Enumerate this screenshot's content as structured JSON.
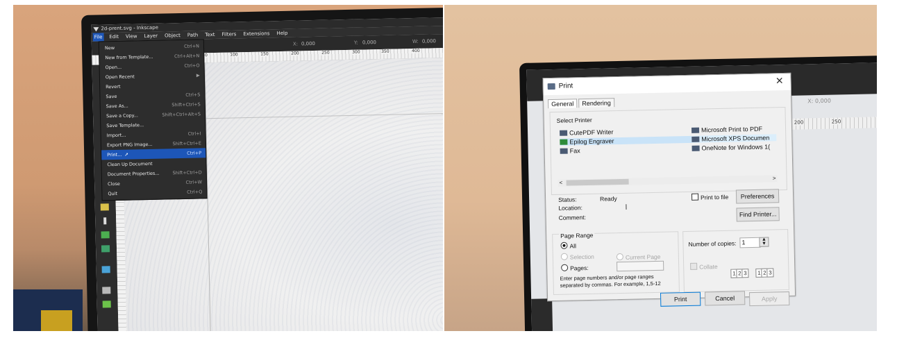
{
  "left": {
    "window_title": "2d-prent.svg - Inkscape",
    "menubar": [
      "File",
      "Edit",
      "View",
      "Layer",
      "Object",
      "Path",
      "Text",
      "Filters",
      "Extensions",
      "Help"
    ],
    "toolbar": {
      "x_label": "X:",
      "x_value": "0,000",
      "y_label": "Y:",
      "y_value": "0,000",
      "w_label": "W:",
      "w_value": "0,000"
    },
    "ruler": [
      "50",
      "100",
      "150",
      "200",
      "250",
      "300",
      "350",
      "400"
    ],
    "file_menu": [
      {
        "label": "New",
        "shortcut": "Ctrl+N"
      },
      {
        "label": "New from Template...",
        "shortcut": "Ctrl+Alt+N"
      },
      {
        "label": "Open...",
        "shortcut": "Ctrl+O"
      },
      {
        "label": "Open Recent",
        "shortcut": "▶"
      },
      {
        "label": "Revert",
        "shortcut": ""
      },
      {
        "label": "Save",
        "shortcut": "Ctrl+S"
      },
      {
        "label": "Save As...",
        "shortcut": "Shift+Ctrl+S"
      },
      {
        "label": "Save a Copy...",
        "shortcut": "Shift+Ctrl+Alt+S"
      },
      {
        "label": "Save Template...",
        "shortcut": ""
      },
      {
        "label": "Import...",
        "shortcut": "Ctrl+I"
      },
      {
        "label": "Export PNG Image...",
        "shortcut": "Shift+Ctrl+E"
      },
      {
        "label": "Print...",
        "shortcut": "Ctrl+P"
      },
      {
        "label": "Clean Up Document",
        "shortcut": ""
      },
      {
        "label": "Document Properties...",
        "shortcut": "Shift+Ctrl+D"
      },
      {
        "label": "Close",
        "shortcut": "Ctrl+W"
      },
      {
        "label": "Quit",
        "shortcut": "Ctrl+Q"
      }
    ],
    "selected_item": "Print..."
  },
  "right": {
    "bg_toolbar": {
      "x_label": "X:",
      "x_value": "0,000"
    },
    "bg_ruler": [
      "200",
      "250"
    ],
    "dialog": {
      "title": "Print",
      "close": "✕",
      "tabs": [
        "General",
        "Rendering"
      ],
      "select_printer_label": "Select Printer",
      "printers_col1": [
        "CutePDF Writer",
        "Epilog Engraver",
        "Fax"
      ],
      "printers_col2": [
        "Microsoft Print to PDF",
        "Microsoft XPS Documen",
        "OneNote for Windows 1("
      ],
      "selected_printer": "Epilog Engraver",
      "scroll_left": "<",
      "scroll_right": ">",
      "status_label": "Status:",
      "status_value": "Ready",
      "location_label": "Location:",
      "comment_label": "Comment:",
      "print_to_file": "Print to file",
      "preferences": "Preferences",
      "find_printer": "Find Printer...",
      "page_range_label": "Page Range",
      "all": "All",
      "selection": "Selection",
      "current_page": "Current Page",
      "pages": "Pages:",
      "pages_hint_1": "Enter page numbers and/or page ranges",
      "pages_hint_2": "separated by commas.  For example, 1,5-12",
      "copies_label": "Number of copies:",
      "copies_value": "1",
      "collate": "Collate",
      "collate_digits": [
        "1",
        "2",
        "3"
      ],
      "print_btn": "Print",
      "cancel_btn": "Cancel",
      "apply_btn": "Apply"
    }
  }
}
